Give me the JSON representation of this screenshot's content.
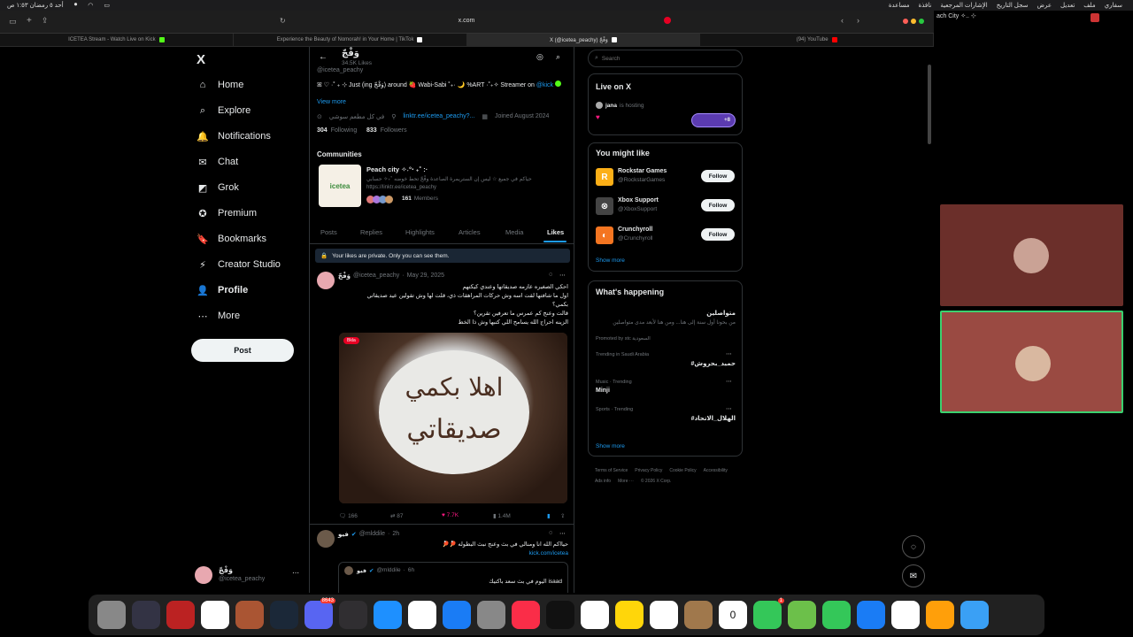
{
  "menubar": {
    "time": "أحد ٥ رمضان ١:٥٣ ص",
    "items": [
      "سفاري",
      "ملف",
      "تعديل",
      "عرض",
      "سجل التاريخ",
      "الإشارات المرجعية",
      "نافذة",
      "مساعدة"
    ]
  },
  "browser": {
    "address": "x.com",
    "tabs": [
      {
        "label": "ICETEA Stream - Watch Live on Kick",
        "color": "#53fc18"
      },
      {
        "label": "Experience the Beauty of Nomorah! in Your Home | TikTok",
        "color": "#fff"
      },
      {
        "label": "X (@icetea_peachy) وَفْجّ",
        "color": "#fff",
        "active": true
      },
      {
        "label": "(94) YouTube",
        "color": "#ff0000"
      }
    ],
    "right_window_title": "ach City ✧.. ⊹"
  },
  "nav": {
    "logo": "X",
    "items": [
      {
        "label": "Home",
        "icon": "home-icon",
        "glyph": "⌂"
      },
      {
        "label": "Explore",
        "icon": "search-icon",
        "glyph": "⌕"
      },
      {
        "label": "Notifications",
        "icon": "bell-icon",
        "glyph": "🔔"
      },
      {
        "label": "Chat",
        "icon": "mail-icon",
        "glyph": "✉"
      },
      {
        "label": "Grok",
        "icon": "grok-icon",
        "glyph": "◩"
      },
      {
        "label": "Premium",
        "icon": "premium-icon",
        "glyph": "✪"
      },
      {
        "label": "Bookmarks",
        "icon": "bookmark-icon",
        "glyph": "🔖"
      },
      {
        "label": "Creator Studio",
        "icon": "creator-icon",
        "glyph": "⚡"
      },
      {
        "label": "Profile",
        "icon": "profile-icon",
        "glyph": "👤"
      },
      {
        "label": "More",
        "icon": "more-icon",
        "glyph": "⋯"
      }
    ],
    "post_label": "Post",
    "account_name": "وَفْجّ",
    "account_handle": "@icetea_peachy"
  },
  "profile": {
    "name": "وَفْجّ",
    "posts_count": "34.5K Likes",
    "handle": "@icetea_peachy",
    "bio": "ꕤ ♡ ·˚ ₊ ⊹ Just (ing وَفْجّ) around 🍓 Wabi-Sabi ˚₊· 🌙 %ART ·˚₊✧ Streamer on",
    "bio_link": "@kick",
    "view_more": "View more",
    "location": "في كل مطعم سوشي",
    "website": "linktr.ee/icetea_peachy?...",
    "joined": "Joined August 2024",
    "following_count": "304",
    "following_label": "Following",
    "followers_count": "833",
    "followers_label": "Followers"
  },
  "communities": {
    "heading": "Communities",
    "name": "Peach city ✧˖°‧ ₊˚ :·",
    "desc": "حياكم في جميع ☆ ليس إن الستريمرة الصاعدة وفْجّ تحط خوضه ˚₊✧ حسابي https://linktr.ee/icetea_peachy",
    "members_count": "161",
    "members_label": "Members",
    "thumb_text": "icetea"
  },
  "profile_tabs": [
    "Posts",
    "Replies",
    "Highlights",
    "Articles",
    "Media",
    "Likes"
  ],
  "privacy_note": "Your likes are private. Only you can see them.",
  "tweet1": {
    "name": "وَفْجّ",
    "handle": "@icetea_peachy",
    "date": "May 29, 2025",
    "lines": [
      "احكي الصغيره عازمه صديقاتها وعندي كيكتهم",
      "اول ما شافتها لقت اسه وش حركات المراهقات ذي، قلت لها وش تقولين عيد صديقاتي",
      "بكمي؟",
      "قالت وعنج كم عمرس ما تعرفين تقرين؟",
      "الزينه احراج الله يسامح اللي كتبها وش ذا الخط"
    ],
    "image_label": "Bkla",
    "cake_line1": "اهلا بكمي",
    "cake_line2": "صديقاتي",
    "replies": "166",
    "reposts": "87",
    "likes": "7.7K",
    "views": "1.4M"
  },
  "tweet2": {
    "name": "فيو",
    "handle": "@mlddile",
    "time": "2h",
    "text": "حيااكم الله انا ومنالي في بث وعنج نبث البطوله 🏓🏓",
    "link": "kick.com/icetea",
    "quote_name": "فيو",
    "quote_handle": "@mlddile",
    "quote_time": "6h",
    "quote_text": "اليوم في بث سعد باكتيك isaad"
  },
  "search": {
    "placeholder": "Search"
  },
  "live": {
    "heading": "Live on X",
    "host": "jana",
    "host_status": "is hosting",
    "listeners": "+8"
  },
  "you_might_like": {
    "heading": "You might like",
    "accounts": [
      {
        "name": "Rockstar Games",
        "handle": "@RockstarGames",
        "color": "#fcaf17",
        "glyph": "R"
      },
      {
        "name": "Xbox Support",
        "handle": "@XboxSupport",
        "color": "#444",
        "glyph": "⊗"
      },
      {
        "name": "Crunchyroll",
        "handle": "@Crunchyroll",
        "color": "#f47521",
        "glyph": "◐"
      }
    ],
    "follow_label": "Follow",
    "show_more": "Show more"
  },
  "whats_happening": {
    "heading": "What's happening",
    "promo_title": "متواصلين",
    "promo_text": "من بحونا أول سنة إلى هنا... ومن هنا لأبعد مدى متواصلين",
    "promo_by": "Promoted by stc السعودية",
    "trends": [
      {
        "context": "Trending in Saudi Arabia",
        "name": "#حميد_بحروش"
      },
      {
        "context": "Music · Trending",
        "name": "Minji"
      },
      {
        "context": "Sports · Trending",
        "name": "#الهلال_الاتحاد"
      }
    ],
    "show_more": "Show more"
  },
  "footer_links": [
    "Terms of Service",
    "Privacy Policy",
    "Cookie Policy",
    "Accessibility",
    "Ads info",
    "More ···",
    "© 2026 X Corp."
  ],
  "dock": {
    "apps": [
      {
        "name": "trash",
        "color": "#888"
      },
      {
        "name": "screenshot",
        "color": "#334"
      },
      {
        "name": "opera-gx",
        "color": "#b22"
      },
      {
        "name": "opera",
        "color": "#fff"
      },
      {
        "name": "game",
        "color": "#a53"
      },
      {
        "name": "steam",
        "color": "#1b2838"
      },
      {
        "name": "discord",
        "color": "#5865f2",
        "badge": "8643"
      },
      {
        "name": "obs",
        "color": "#302e31"
      },
      {
        "name": "safari",
        "color": "#1e90ff"
      },
      {
        "name": "photos",
        "color": "#fff"
      },
      {
        "name": "app-store",
        "color": "#1a7cf5"
      },
      {
        "name": "settings",
        "color": "#888"
      },
      {
        "name": "music",
        "color": "#fa2d48"
      },
      {
        "name": "tv",
        "color": "#111"
      },
      {
        "name": "freeform",
        "color": "#fff"
      },
      {
        "name": "notes",
        "color": "#ffd60a"
      },
      {
        "name": "reminders",
        "color": "#fff"
      },
      {
        "name": "contacts",
        "color": "#a0784c"
      },
      {
        "name": "calendar",
        "color": "#fff",
        "label": "0"
      },
      {
        "name": "facetime",
        "color": "#34c759",
        "badge": "1"
      },
      {
        "name": "maps",
        "color": "#6cc04a"
      },
      {
        "name": "messages",
        "color": "#34c759"
      },
      {
        "name": "mail",
        "color": "#1a7cf5"
      },
      {
        "name": "opera-2",
        "color": "#fff"
      },
      {
        "name": "launchpad",
        "color": "#ff9f0a"
      },
      {
        "name": "finder",
        "color": "#3aa0f5"
      }
    ]
  }
}
